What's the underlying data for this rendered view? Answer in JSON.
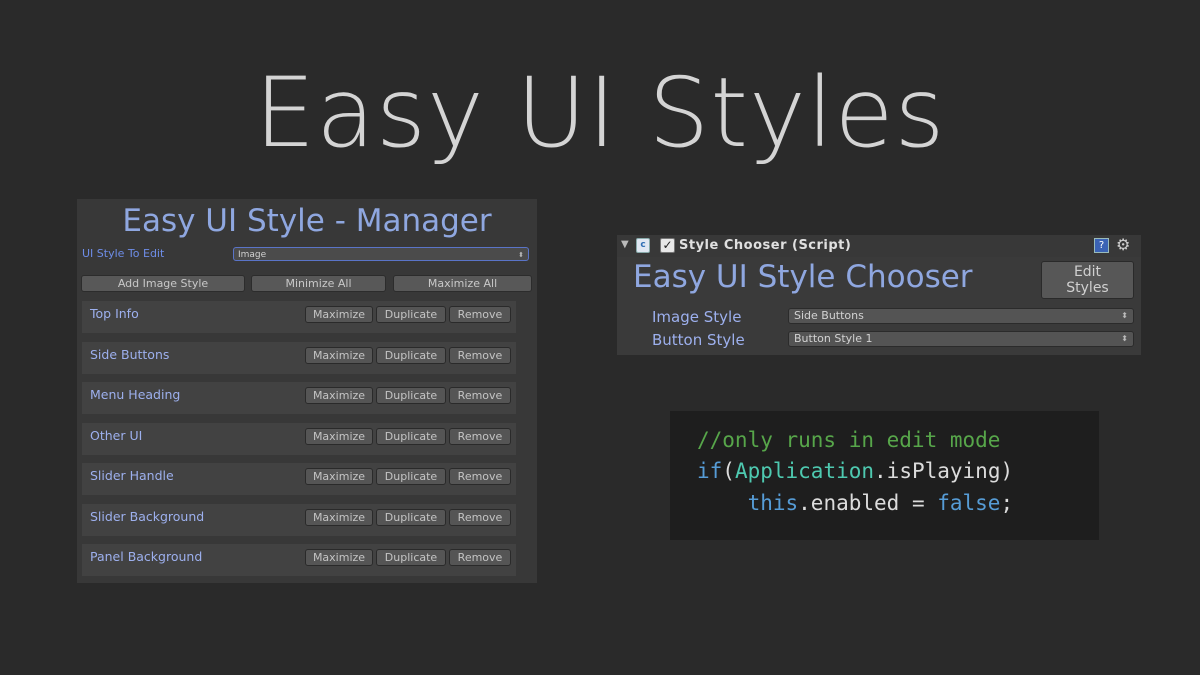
{
  "page": {
    "title": "Easy UI Styles"
  },
  "manager": {
    "title": "Easy UI Style - Manager",
    "style_label": "UI Style To Edit",
    "style_value": "Image",
    "add_button": "Add Image Style",
    "minimize_all": "Minimize All",
    "maximize_all": "Maximize All",
    "rows": [
      {
        "label": "Top Info"
      },
      {
        "label": "Side Buttons"
      },
      {
        "label": "Menu Heading"
      },
      {
        "label": "Other UI"
      },
      {
        "label": "Slider Handle"
      },
      {
        "label": "Slider Background"
      },
      {
        "label": "Panel Background"
      }
    ],
    "row_buttons": {
      "maximize": "Maximize",
      "duplicate": "Duplicate",
      "remove": "Remove"
    }
  },
  "chooser": {
    "component_title": "Style Chooser (Script)",
    "title": "Easy UI Style Chooser",
    "edit_button_line1": "Edit",
    "edit_button_line2": "Styles",
    "image_style_label": "Image Style",
    "image_style_value": "Side Buttons",
    "button_style_label": "Button Style",
    "button_style_value": "Button Style 1"
  },
  "code": {
    "comment": "//only runs in edit mode",
    "line2_kw": "if",
    "line2_paren_open": "(",
    "line2_type": "Application",
    "line2_rest": ".isPlaying)",
    "line3_indent": "    ",
    "line3_kw": "this",
    "line3_mid": ".enabled = ",
    "line3_kw2": "false",
    "line3_end": ";"
  },
  "colors": {
    "background": "#2a2a2a",
    "accent_blue": "#8fa7e0",
    "comment_green": "#57a64a",
    "keyword_blue": "#569cd6",
    "type_teal": "#4ec9b0"
  },
  "icons": {
    "fold": "triangle-down-icon",
    "script": "script-icon",
    "help": "help-book-icon",
    "settings": "gear-icon",
    "dropdown": "up-down-arrow-icon"
  }
}
